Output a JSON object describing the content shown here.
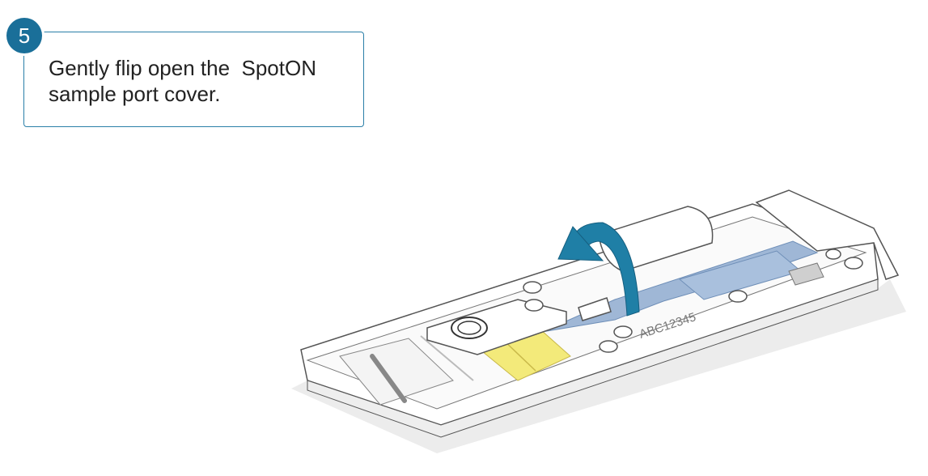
{
  "step": {
    "number": "5",
    "line1": "Gently flip open the  SpotON",
    "line2": "sample port cover."
  },
  "illustration": {
    "device_label": "ABC12345",
    "colors": {
      "accent": "#1a6f99",
      "arrow": "#1f7fa6",
      "flow_channel": "#9fb7d6",
      "sample_pad": "#f3ea7a",
      "outline": "#555555",
      "shadow": "#e8e8e8"
    },
    "icons": [
      "flip-arrow-icon",
      "screw-icon",
      "spoton-port-icon"
    ]
  }
}
